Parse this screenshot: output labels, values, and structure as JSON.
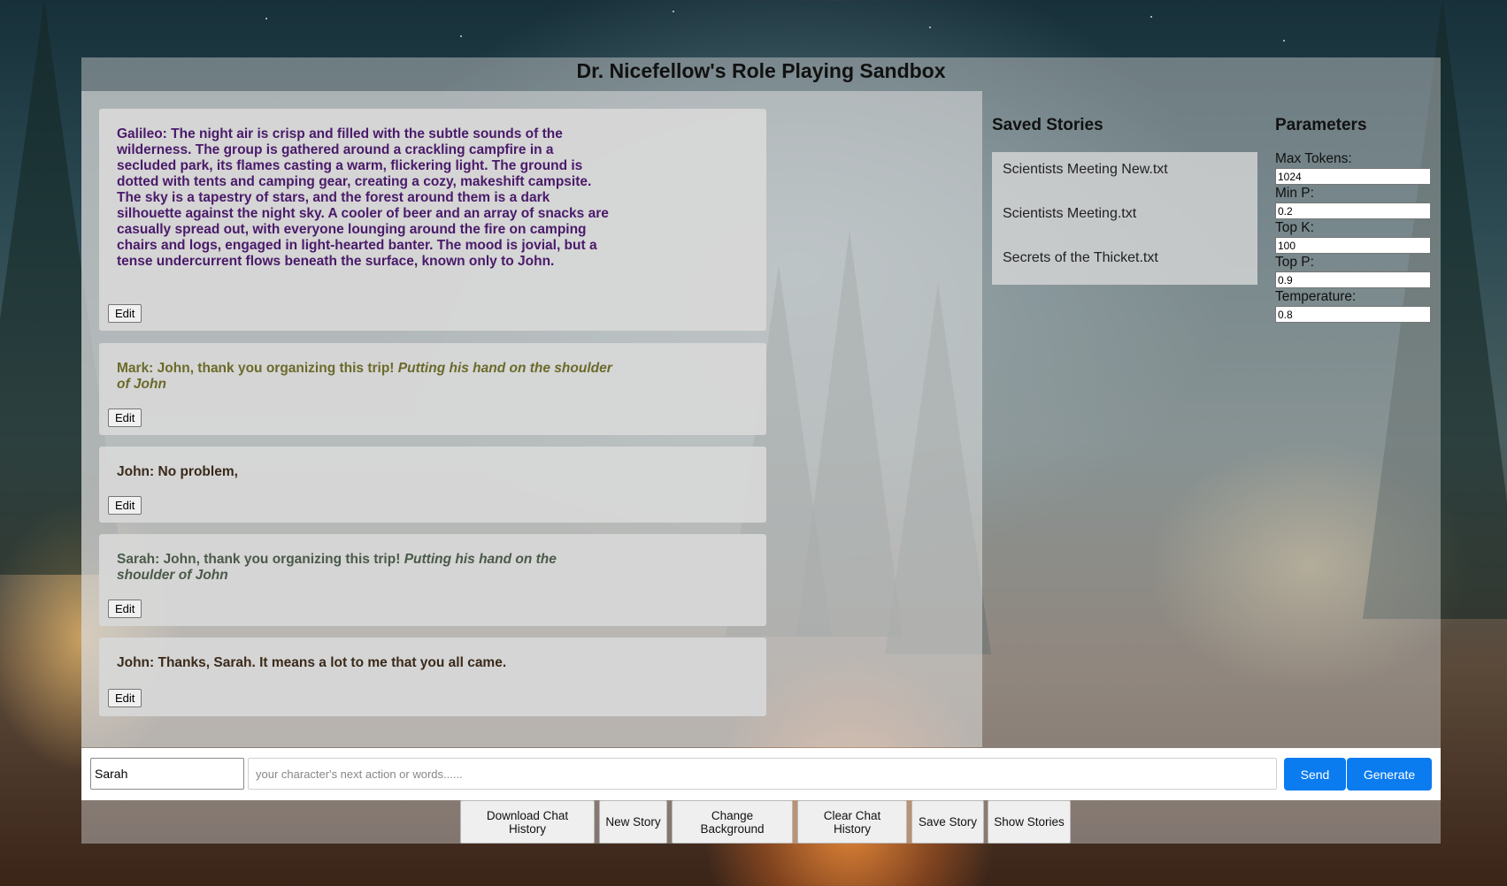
{
  "app": {
    "title": "Dr. Nicefellow's Role Playing Sandbox"
  },
  "messages": [
    {
      "speaker": "Galileo:",
      "text": "The night air is crisp and filled with the subtle sounds of the wilderness. The group is gathered around a crackling campfire in a secluded park, its flames casting a warm, flickering light. The ground is dotted with tents and camping gear, creating a cozy, makeshift campsite. The sky is a tapestry of stars, and the forest around them is a dark silhouette against the night sky. A cooler of beer and an array of snacks are casually spread out, with everyone lounging around the fire on camping chairs and logs, engaged in light-hearted banter. The mood is jovial, but a tense undercurrent flows beneath the surface, known only to John.",
      "action": "",
      "color": "#4a1a6a",
      "edit_label": "Edit"
    },
    {
      "speaker": "Mark:",
      "text": "John, thank you organizing this trip!",
      "action": "Putting his hand on the shoulder of John",
      "color": "#6b6a2a",
      "edit_label": "Edit"
    },
    {
      "speaker": "John:",
      "text": "No problem,",
      "action": "",
      "color": "#3a2a1a",
      "edit_label": "Edit"
    },
    {
      "speaker": "Sarah:",
      "text": "John, thank you organizing this trip!",
      "action": "Putting his hand on the shoulder of John",
      "color": "#4a5a4a",
      "edit_label": "Edit"
    },
    {
      "speaker": "John:",
      "text": "Thanks, Sarah. It means a lot to me that you all came.",
      "action": "",
      "color": "#3a2a1a",
      "edit_label": "Edit"
    }
  ],
  "saved_stories": {
    "title": "Saved Stories",
    "items": [
      "Scientists Meeting New.txt",
      "Scientists Meeting.txt",
      "Secrets of the Thicket.txt"
    ]
  },
  "parameters": {
    "title": "Parameters",
    "max_tokens": {
      "label": "Max Tokens:",
      "value": "1024"
    },
    "min_p": {
      "label": "Min P:",
      "value": "0.2"
    },
    "top_k": {
      "label": "Top K:",
      "value": "100"
    },
    "top_p": {
      "label": "Top P:",
      "value": "0.9"
    },
    "temperature": {
      "label": "Temperature:",
      "value": "0.8"
    }
  },
  "input_bar": {
    "character_value": "Sarah",
    "message_placeholder": "your character's next action or words......",
    "send_label": "Send",
    "generate_label": "Generate"
  },
  "actions": {
    "download_label": "Download Chat History",
    "new_story_label": "New Story",
    "change_background_label": "Change Background",
    "clear_history_label": "Clear Chat History",
    "save_story_label": "Save Story",
    "show_stories_label": "Show Stories"
  },
  "colors": {
    "accent": "#0b7bf0",
    "panel": "#d6d6d6"
  }
}
